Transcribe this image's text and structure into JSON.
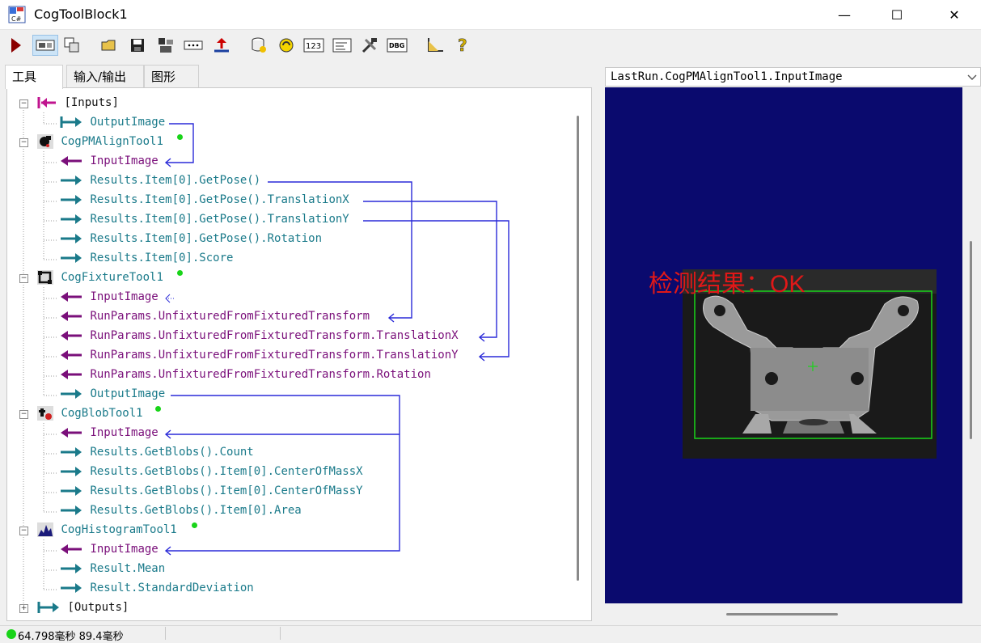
{
  "window": {
    "title": "CogToolBlock1",
    "minimize_glyph": "—",
    "maximize_glyph": "☐",
    "close_glyph": "✕"
  },
  "toolbar": {
    "buttons": [
      "run-icon",
      "display-icon",
      "copy-icon",
      "open-icon",
      "save-icon",
      "tool-icon",
      "ellipsis-icon",
      "import-icon",
      "database-icon",
      "sync-icon",
      "numbers-icon",
      "terminal-icon",
      "build-icon",
      "debug-icon",
      "ruler-icon",
      "help-icon"
    ],
    "numbers_label": "123",
    "debug_label": "DBG"
  },
  "tabs": [
    "工具",
    "输入/输出",
    "图形"
  ],
  "tree": {
    "inputs": "[Inputs]",
    "outputs": "[Outputs]",
    "nodes": [
      {
        "label": "OutputImage"
      },
      {
        "label": "CogPMAlignTool1"
      },
      {
        "label": "InputImage"
      },
      {
        "label": "Results.Item[0].GetPose()"
      },
      {
        "label": "Results.Item[0].GetPose().TranslationX"
      },
      {
        "label": "Results.Item[0].GetPose().TranslationY"
      },
      {
        "label": "Results.Item[0].GetPose().Rotation"
      },
      {
        "label": "Results.Item[0].Score"
      },
      {
        "label": "CogFixtureTool1"
      },
      {
        "label": "InputImage"
      },
      {
        "label": "RunParams.UnfixturedFromFixturedTransform"
      },
      {
        "label": "RunParams.UnfixturedFromFixturedTransform.TranslationX"
      },
      {
        "label": "RunParams.UnfixturedFromFixturedTransform.TranslationY"
      },
      {
        "label": "RunParams.UnfixturedFromFixturedTransform.Rotation"
      },
      {
        "label": "OutputImage"
      },
      {
        "label": "CogBlobTool1"
      },
      {
        "label": "InputImage"
      },
      {
        "label": "Results.GetBlobs().Count"
      },
      {
        "label": "Results.GetBlobs().Item[0].CenterOfMassX"
      },
      {
        "label": "Results.GetBlobs().Item[0].CenterOfMassY"
      },
      {
        "label": "Results.GetBlobs().Item[0].Area"
      },
      {
        "label": "CogHistogramTool1"
      },
      {
        "label": "InputImage"
      },
      {
        "label": "Result.Mean"
      },
      {
        "label": "Result.StandardDeviation"
      }
    ]
  },
  "image_panel": {
    "selected_image": "LastRun.CogPMAlignTool1.InputImage",
    "overlay_text": "检测结果：OK"
  },
  "status": {
    "text": "64.798毫秒 89.4毫秒"
  },
  "colors": {
    "link_line": "#2a2ad8",
    "input_arrow": "#7a0f7a",
    "output_arrow": "#1a7a8a",
    "image_bg": "#0a0a6e",
    "region_box": "#19d419",
    "result_text": "#e01818"
  }
}
